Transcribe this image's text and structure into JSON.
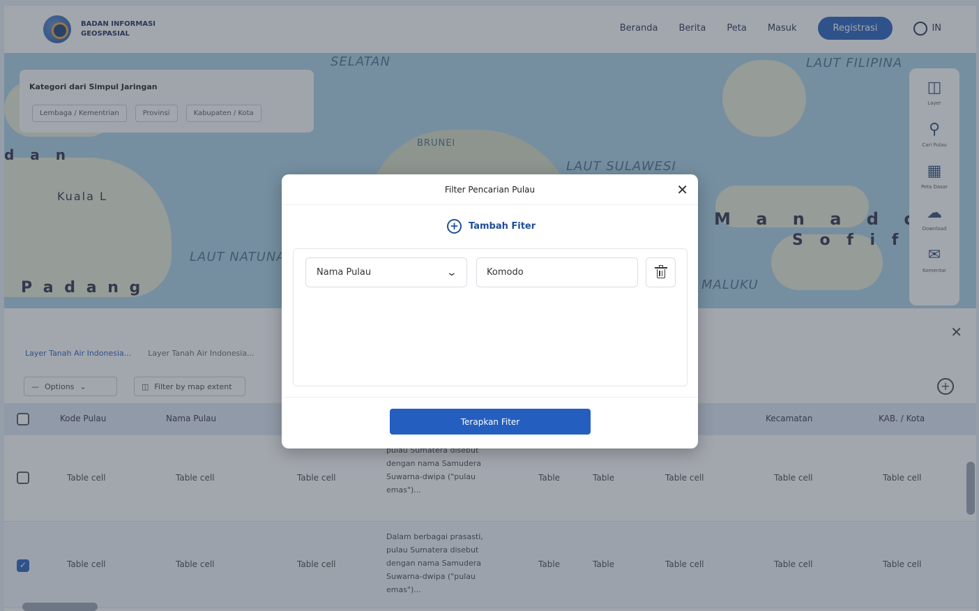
{
  "header": {
    "org_line1": "BADAN INFORMASI",
    "org_line2": "GEOSPASIAL",
    "nav": [
      "Beranda",
      "Berita",
      "Peta",
      "Masuk"
    ],
    "register_label": "Registrasi",
    "language": "IN"
  },
  "map": {
    "labels": [
      "SELATAN",
      "LAUT FILIPINA",
      "LAUT SULAWESI",
      "LAUT NATUNA",
      "MALUKU",
      "BRUNEI"
    ],
    "cities": [
      "d a n",
      "Kuala L",
      "P a d a n g",
      "M a n a d o",
      "S o f i f i"
    ],
    "category_card": {
      "title": "Kategori dari Simpul Jaringan",
      "chips": [
        "Lembaga / Kementrian",
        "Provinsi",
        "Kabupaten / Kota"
      ]
    },
    "tools": [
      {
        "icon": "layers-icon",
        "label": "Layer"
      },
      {
        "icon": "search-icon",
        "label": "Cari Pulau"
      },
      {
        "icon": "map-icon",
        "label": "Peta Dasar"
      },
      {
        "icon": "download-icon",
        "label": "Download"
      },
      {
        "icon": "chat-icon",
        "label": "Komentar"
      }
    ]
  },
  "panel": {
    "tabs": [
      "Layer Tanah Air Indonesia...",
      "Layer Tanah Air Indonesia..."
    ],
    "toolbar": {
      "options_label": "Options",
      "filter_extent_label": "Filter by map extent"
    },
    "columns": [
      "Kode Pulau",
      "Nama Pulau",
      "",
      "",
      "",
      "",
      "Kecamatan",
      "KAB. / Kota"
    ],
    "rows": [
      {
        "checked": false,
        "c1": "Table cell",
        "c2": "Table cell",
        "c3": "Table cell",
        "desc": "pulau Sumatera disebut dengan nama Samudera Suwarna-dwipa (\"pulau emas\")...",
        "c5": "Table",
        "c6": "Table",
        "c7": "Table cell",
        "c8": "Table cell",
        "c9": "Table cell"
      },
      {
        "checked": true,
        "c1": "Table cell",
        "c2": "Table cell",
        "c3": "Table cell",
        "desc": "Dalam berbagai prasasti, pulau Sumatera disebut dengan nama Samudera Suwarna-dwipa (\"pulau emas\")...",
        "c5": "Table",
        "c6": "Table",
        "c7": "Table cell",
        "c8": "Table cell",
        "c9": "Table cell"
      }
    ]
  },
  "modal": {
    "title": "Filter Pencarian Pulau",
    "add_filter_label": "Tambah Fiter",
    "filter": {
      "field_selected": "Nama Pulau",
      "value": "Komodo"
    },
    "apply_label": "Terapkan Fiter"
  },
  "colors": {
    "primary": "#245fbf",
    "overlay": "rgba(60,68,84,0.48)"
  }
}
